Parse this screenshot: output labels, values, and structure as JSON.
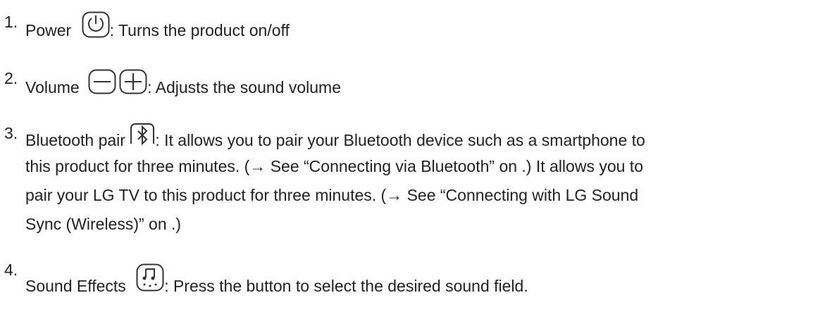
{
  "items": [
    {
      "number": "1.",
      "label": "Power",
      "description": ": Turns the product on/off",
      "icon": "power-icon"
    },
    {
      "number": "2.",
      "label": "Volume",
      "description": ": Adjusts the sound volume",
      "icons": [
        "minus-icon",
        "plus-icon"
      ]
    },
    {
      "number": "3.",
      "label": "Bluetooth pair",
      "icon": "bluetooth-icon",
      "description_lines": [
        ": It allows you to pair your Bluetooth device such as a smartphone to",
        "this product for three minutes. (→ See “Connecting via Bluetooth” on .) It allows you to",
        "pair your LG TV to this product for three minutes. (→ See “Connecting with LG Sound",
        "Sync (Wireless)” on .)"
      ]
    },
    {
      "number": "4.",
      "label": "Sound Effects",
      "description": ": Press the button to select the desired sound field.",
      "icon": "sound-effect-icon"
    }
  ]
}
